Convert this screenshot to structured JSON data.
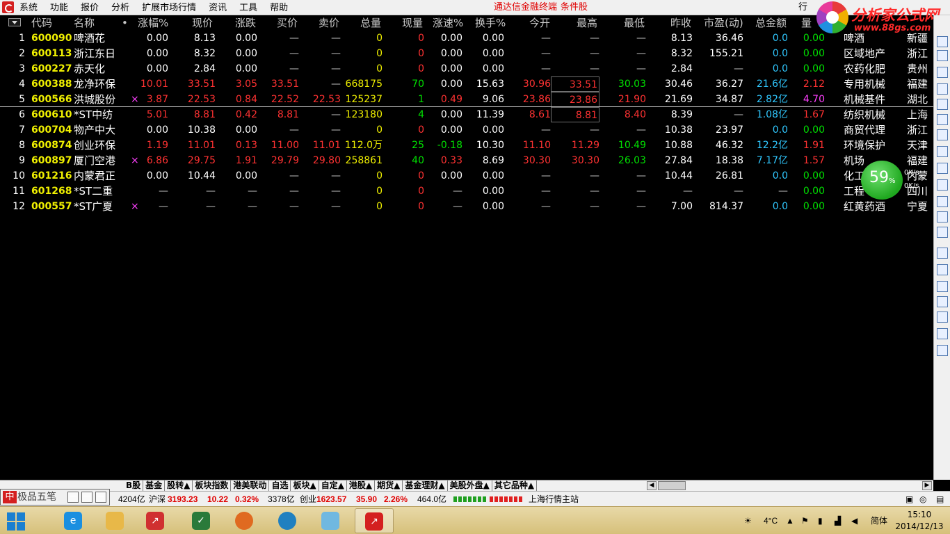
{
  "menu": {
    "items": [
      "系统",
      "功能",
      "报价",
      "分析",
      "扩展市场行情",
      "资讯",
      "工具",
      "帮助"
    ],
    "center_link_1": "通达信金融终端",
    "center_link_2": "条件股",
    "cut_label": "行"
  },
  "logo": {
    "title": "分析家公式网",
    "url": "www.88gs.com"
  },
  "table": {
    "headers": [
      "代码",
      "名称",
      "•",
      "涨幅%",
      "现价",
      "涨跌",
      "买价",
      "卖价",
      "总量",
      "现量",
      "涨速%",
      "换手%",
      "今开",
      "最高",
      "最低",
      "昨收",
      "市盈(动)",
      "总金额",
      "量"
    ],
    "rows": [
      {
        "no": "1",
        "code": "600090",
        "name": "啤酒花",
        "flag": "",
        "chg_pct": "0.00",
        "price": "8.13",
        "chg": "0.00",
        "bid": "—",
        "ask": "—",
        "volume": "0",
        "cur_vol": "0",
        "speed": "0.00",
        "turnover": "0.00",
        "open": "—",
        "high": "—",
        "low": "—",
        "prev": "8.13",
        "pe": "36.46",
        "amount": "0.0",
        "ratio": "0.00",
        "industry": "啤酒",
        "region": "新疆"
      },
      {
        "no": "2",
        "code": "600113",
        "name": "浙江东日",
        "flag": "",
        "chg_pct": "0.00",
        "price": "8.32",
        "chg": "0.00",
        "bid": "—",
        "ask": "—",
        "volume": "0",
        "cur_vol": "0",
        "speed": "0.00",
        "turnover": "0.00",
        "open": "—",
        "high": "—",
        "low": "—",
        "prev": "8.32",
        "pe": "155.21",
        "amount": "0.0",
        "ratio": "0.00",
        "industry": "区域地产",
        "region": "浙江"
      },
      {
        "no": "3",
        "code": "600227",
        "name": "赤天化",
        "flag": "",
        "chg_pct": "0.00",
        "price": "2.84",
        "chg": "0.00",
        "bid": "—",
        "ask": "—",
        "volume": "0",
        "cur_vol": "0",
        "speed": "0.00",
        "turnover": "0.00",
        "open": "—",
        "high": "—",
        "low": "—",
        "prev": "2.84",
        "pe": "—",
        "amount": "0.0",
        "ratio": "0.00",
        "industry": "农药化肥",
        "region": "贵州"
      },
      {
        "no": "4",
        "code": "600388",
        "name": "龙净环保",
        "flag": "",
        "chg_pct": "10.01",
        "price": "33.51",
        "chg": "3.05",
        "bid": "33.51",
        "ask": "—",
        "volume": "668175",
        "cur_vol": "70",
        "speed": "0.00",
        "turnover": "15.63",
        "open": "30.96",
        "high": "33.51",
        "low": "30.03",
        "prev": "30.46",
        "pe": "36.27",
        "amount": "21.6亿",
        "ratio": "2.12",
        "industry": "专用机械",
        "region": "福建"
      },
      {
        "no": "5",
        "code": "600566",
        "name": "洪城股份",
        "flag": "×",
        "chg_pct": "3.87",
        "price": "22.53",
        "chg": "0.84",
        "bid": "22.52",
        "ask": "22.53",
        "volume": "125237",
        "cur_vol": "1",
        "speed": "0.49",
        "turnover": "9.06",
        "open": "23.86",
        "high": "23.86",
        "low": "21.90",
        "prev": "21.69",
        "pe": "34.87",
        "amount": "2.82亿",
        "ratio": "4.70",
        "industry": "机械基件",
        "region": "湖北"
      },
      {
        "no": "6",
        "code": "600610",
        "name": "*ST中纺",
        "flag": "",
        "chg_pct": "5.01",
        "price": "8.81",
        "chg": "0.42",
        "bid": "8.81",
        "ask": "—",
        "volume": "123180",
        "cur_vol": "4",
        "speed": "0.00",
        "turnover": "11.39",
        "open": "8.61",
        "high": "8.81",
        "low": "8.40",
        "prev": "8.39",
        "pe": "—",
        "amount": "1.08亿",
        "ratio": "1.67",
        "industry": "纺织机械",
        "region": "上海"
      },
      {
        "no": "7",
        "code": "600704",
        "name": "物产中大",
        "flag": "",
        "chg_pct": "0.00",
        "price": "10.38",
        "chg": "0.00",
        "bid": "—",
        "ask": "—",
        "volume": "0",
        "cur_vol": "0",
        "speed": "0.00",
        "turnover": "0.00",
        "open": "—",
        "high": "—",
        "low": "—",
        "prev": "10.38",
        "pe": "23.97",
        "amount": "0.0",
        "ratio": "0.00",
        "industry": "商贸代理",
        "region": "浙江"
      },
      {
        "no": "8",
        "code": "600874",
        "name": "创业环保",
        "flag": "",
        "chg_pct": "1.19",
        "price": "11.01",
        "chg": "0.13",
        "bid": "11.00",
        "ask": "11.01",
        "volume": "112.0万",
        "cur_vol": "25",
        "speed": "-0.18",
        "turnover": "10.30",
        "open": "11.10",
        "high": "11.29",
        "low": "10.49",
        "prev": "10.88",
        "pe": "46.32",
        "amount": "12.2亿",
        "ratio": "1.91",
        "industry": "环境保护",
        "region": "天津"
      },
      {
        "no": "9",
        "code": "600897",
        "name": "厦门空港",
        "flag": "×",
        "chg_pct": "6.86",
        "price": "29.75",
        "chg": "1.91",
        "bid": "29.79",
        "ask": "29.80",
        "volume": "258861",
        "cur_vol": "40",
        "speed": "0.33",
        "turnover": "8.69",
        "open": "30.30",
        "high": "30.30",
        "low": "26.03",
        "prev": "27.84",
        "pe": "18.38",
        "amount": "7.17亿",
        "ratio": "1.57",
        "industry": "机场",
        "region": "福建"
      },
      {
        "no": "10",
        "code": "601216",
        "name": "内蒙君正",
        "flag": "",
        "chg_pct": "0.00",
        "price": "10.44",
        "chg": "0.00",
        "bid": "—",
        "ask": "—",
        "volume": "0",
        "cur_vol": "0",
        "speed": "0.00",
        "turnover": "0.00",
        "open": "—",
        "high": "—",
        "low": "—",
        "prev": "10.44",
        "pe": "26.81",
        "amount": "0.0",
        "ratio": "0.00",
        "industry": "化工",
        "region": "内蒙"
      },
      {
        "no": "11",
        "code": "601268",
        "name": "*ST二重",
        "flag": "",
        "chg_pct": "—",
        "price": "—",
        "chg": "—",
        "bid": "—",
        "ask": "—",
        "volume": "0",
        "cur_vol": "0",
        "speed": "—",
        "turnover": "0.00",
        "open": "—",
        "high": "—",
        "low": "—",
        "prev": "—",
        "pe": "—",
        "amount": "—",
        "ratio": "0.00",
        "industry": "工程",
        "region": "四川"
      },
      {
        "no": "12",
        "code": "000557",
        "name": "*ST广夏",
        "flag": "×",
        "chg_pct": "—",
        "price": "—",
        "chg": "—",
        "bid": "—",
        "ask": "—",
        "volume": "0",
        "cur_vol": "0",
        "speed": "—",
        "turnover": "0.00",
        "open": "—",
        "high": "—",
        "low": "—",
        "prev": "7.00",
        "pe": "814.37",
        "amount": "0.0",
        "ratio": "0.00",
        "industry": "红黄药酒",
        "region": "宁夏"
      }
    ]
  },
  "overlay": {
    "progress_pct": 59,
    "pct_sign": "%",
    "speed_up": "0K/s",
    "speed_down": "0K/s"
  },
  "tabs": [
    "B股",
    "基金",
    "股转▲",
    "板块指数",
    "港美联动",
    "自选",
    "板块▲",
    "自定▲",
    "港股▲",
    "期货▲",
    "基金理财▲",
    "美股外盘▲",
    "其它品种▲"
  ],
  "input": {
    "placeholder": "极品五笔"
  },
  "status": {
    "sh_amount": "4204亿",
    "sz_label": "沪深",
    "sz_index": "3193.23",
    "sz_chg": "10.22",
    "sz_pct": "0.32%",
    "sz_amount": "3378亿",
    "cy_label": "创业",
    "cy_index": "1623.57",
    "cy_chg": "35.90",
    "cy_pct": "2.26%",
    "cy_amount": "464.0亿",
    "server": "上海行情主站"
  },
  "taskbar": {
    "temp": "4°C",
    "ime": "简体",
    "time": "15:10",
    "date": "2014/12/13"
  },
  "colors": {
    "up": "#ff3232",
    "down": "#00e000",
    "flat": "#ffffff",
    "code": "#f0f000",
    "amount": "#30c8ff"
  }
}
